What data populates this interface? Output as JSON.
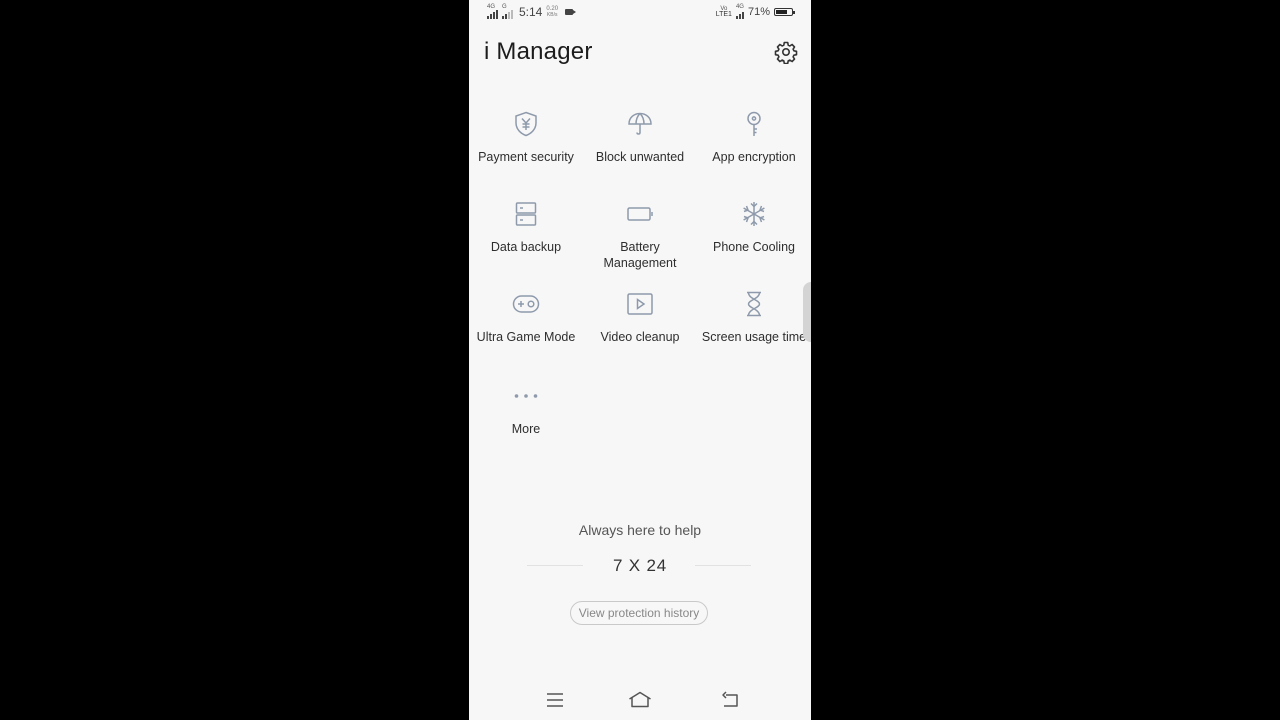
{
  "status_bar": {
    "net1": "4G",
    "net2": "G",
    "time": "5:14",
    "speed_value": "0.20",
    "speed_unit": "KB/s",
    "volte": "Vo",
    "lte": "LTE1",
    "net3": "4G",
    "battery_percent_text": "71%",
    "battery_level": 0.71
  },
  "header": {
    "title": "i Manager",
    "settings_icon": "gear-icon"
  },
  "tiles": [
    {
      "label": "Payment security",
      "icon": "shield-yen-icon"
    },
    {
      "label": "Block unwanted",
      "icon": "umbrella-icon"
    },
    {
      "label": "App encryption",
      "icon": "key-icon"
    },
    {
      "label": "Data backup",
      "icon": "server-icon"
    },
    {
      "label": "Battery Management",
      "icon": "battery-icon"
    },
    {
      "label": "Phone Cooling",
      "icon": "snowflake-icon"
    },
    {
      "label": "Ultra Game Mode",
      "icon": "gamepad-icon"
    },
    {
      "label": "Video cleanup",
      "icon": "video-play-icon"
    },
    {
      "label": "Screen usage time",
      "icon": "hourglass-icon"
    },
    {
      "label": "More",
      "icon": "more-dots-icon"
    }
  ],
  "help": {
    "text": "Always here to help",
    "value": "7 X 24",
    "history_button": "View protection history"
  },
  "nav": {
    "menu_icon": "menu-icon",
    "home_icon": "home-icon",
    "back_icon": "back-icon"
  },
  "colors": {
    "background": "#f7f7f7",
    "icon_stroke": "#8e9aab",
    "text": "#2e2e2e"
  }
}
